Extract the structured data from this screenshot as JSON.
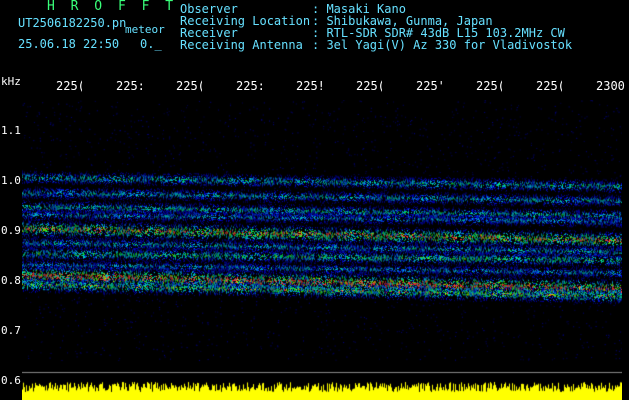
{
  "header": {
    "title": "H R O F F T",
    "filename": "UT2506182250.pn",
    "meteor": "meteor",
    "datetime": "25.06.18 22:50",
    "counter": "0._"
  },
  "info": [
    {
      "label": "Observer",
      "value": ": Masaki Kano"
    },
    {
      "label": "Receiving Location",
      "value": ": Shibukawa, Gunma, Japan"
    },
    {
      "label": "Receiver",
      "value": ": RTL-SDR SDR# 43dB L15 103.2MHz CW"
    },
    {
      "label": "Receiving Antenna",
      "value": ": 3el Yagi(V) Az 330 for Vladivostok"
    }
  ],
  "axis": {
    "y_unit": "kHz",
    "x_ticks": [
      "225(",
      "225:",
      "225(",
      "225:",
      "225!",
      "225(",
      "225'",
      "225(",
      "225(",
      "2300"
    ],
    "y_ticks": [
      "1.1",
      "1.0",
      "0.9",
      "0.8",
      "0.7",
      "0.6"
    ]
  },
  "colors": {
    "background": "#000000",
    "text": "#66e0ff",
    "title": "#39ff7a",
    "noise": "#ffff00"
  },
  "bands": [
    {
      "freq_khz": 1.035,
      "drift": 0.02,
      "intensity": 0.55
    },
    {
      "freq_khz": 1.002,
      "drift": 0.018,
      "intensity": 0.5
    },
    {
      "freq_khz": 0.972,
      "drift": 0.02,
      "intensity": 0.55
    },
    {
      "freq_khz": 0.955,
      "drift": 0.015,
      "intensity": 0.45
    },
    {
      "freq_khz": 0.925,
      "drift": 0.025,
      "intensity": 0.85
    },
    {
      "freq_khz": 0.895,
      "drift": 0.02,
      "intensity": 0.5
    },
    {
      "freq_khz": 0.872,
      "drift": 0.015,
      "intensity": 0.6
    },
    {
      "freq_khz": 0.848,
      "drift": 0.018,
      "intensity": 0.45
    },
    {
      "freq_khz": 0.825,
      "drift": 0.03,
      "intensity": 1.0
    },
    {
      "freq_khz": 0.805,
      "drift": 0.025,
      "intensity": 0.7
    }
  ]
}
